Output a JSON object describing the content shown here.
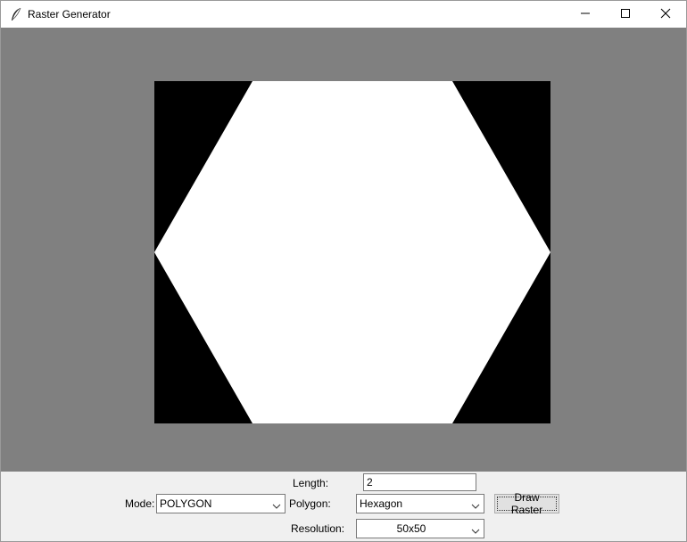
{
  "window": {
    "title": "Raster Generator",
    "icon": "feather-icon",
    "buttons": [
      "minimize-icon",
      "maximize-icon",
      "close-icon"
    ]
  },
  "canvas": {
    "background_color": "#808080",
    "raster_background_color": "#000000",
    "shape_color": "#ffffff",
    "shape": "hexagon"
  },
  "controls": {
    "length": {
      "label": "Length:",
      "value": "2"
    },
    "mode": {
      "label": "Mode:",
      "selected": "POLYGON"
    },
    "polygon": {
      "label": "Polygon:",
      "selected": "Hexagon"
    },
    "draw_button": {
      "label": "Draw Raster"
    },
    "resolution": {
      "label": "Resolution:",
      "selected": "50x50"
    }
  }
}
